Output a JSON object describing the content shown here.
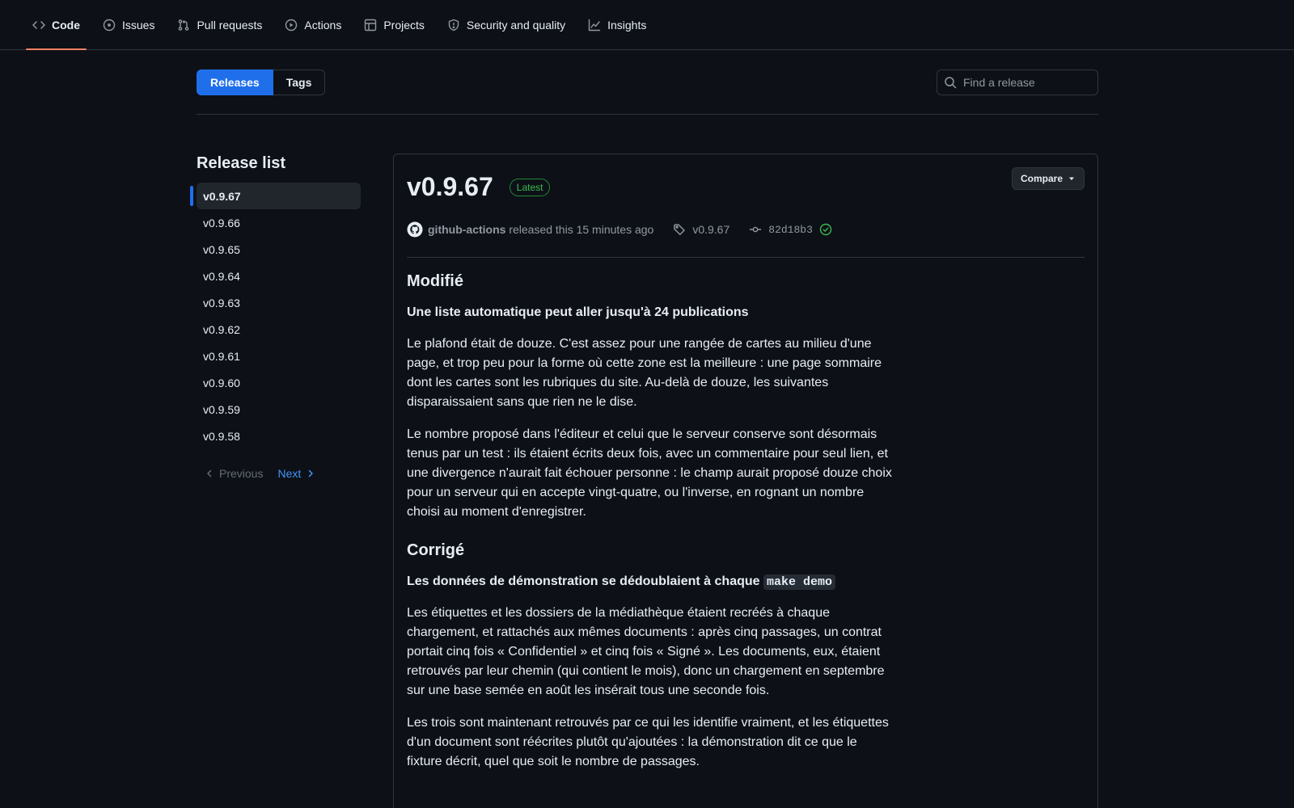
{
  "nav": {
    "tabs": [
      {
        "label": "Code",
        "icon": "code-icon"
      },
      {
        "label": "Issues",
        "icon": "issue-opened-icon"
      },
      {
        "label": "Pull requests",
        "icon": "git-pull-request-icon"
      },
      {
        "label": "Actions",
        "icon": "play-icon"
      },
      {
        "label": "Projects",
        "icon": "table-icon"
      },
      {
        "label": "Security and quality",
        "icon": "shield-icon"
      },
      {
        "label": "Insights",
        "icon": "graph-icon"
      }
    ]
  },
  "subnav": {
    "releases_label": "Releases",
    "tags_label": "Tags",
    "search_placeholder": "Find a release"
  },
  "sidebar": {
    "title": "Release list",
    "items": [
      "v0.9.67",
      "v0.9.66",
      "v0.9.65",
      "v0.9.64",
      "v0.9.63",
      "v0.9.62",
      "v0.9.61",
      "v0.9.60",
      "v0.9.59",
      "v0.9.58"
    ],
    "previous_label": "Previous",
    "next_label": "Next"
  },
  "release": {
    "title": "v0.9.67",
    "badge": "Latest",
    "compare_label": "Compare",
    "author": "github-actions",
    "released_text": "released this 15 minutes ago",
    "tag": "v0.9.67",
    "commit": "82d18b3",
    "sections": {
      "changed_heading": "Modifié",
      "changed_subheading": "Une liste automatique peut aller jusqu'à 24 publications",
      "changed_p1": "Le plafond était de douze. C'est assez pour une rangée de cartes au milieu d'une page, et trop peu pour la forme où cette zone est la meilleure : une page sommaire dont les cartes sont les rubriques du site. Au-delà de douze, les suivantes disparaissaient sans que rien ne le dise.",
      "changed_p2": "Le nombre proposé dans l'éditeur et celui que le serveur conserve sont désormais tenus par un test : ils étaient écrits deux fois, avec un commentaire pour seul lien, et une divergence n'aurait fait échouer personne : le champ aurait proposé douze choix pour un serveur qui en accepte vingt-quatre, ou l'inverse, en rognant un nombre choisi au moment d'enregistrer.",
      "fixed_heading": "Corrigé",
      "fixed_subheading_text": "Les données de démonstration se dédoublaient à chaque",
      "fixed_subheading_code": "make demo",
      "fixed_p1": "Les étiquettes et les dossiers de la médiathèque étaient recréés à chaque chargement, et rattachés aux mêmes documents : après cinq passages, un contrat portait cinq fois « Confidentiel » et cinq fois « Signé ». Les documents, eux, étaient retrouvés par leur chemin (qui contient le mois), donc un chargement en septembre sur une base semée en août les insérait tous une seconde fois.",
      "fixed_p2": "Les trois sont maintenant retrouvés par ce qui les identifie vraiment, et les étiquettes d'un document sont réécrites plutôt qu'ajoutées : la démonstration dit ce que le fixture décrit, quel que soit le nombre de passages."
    }
  }
}
